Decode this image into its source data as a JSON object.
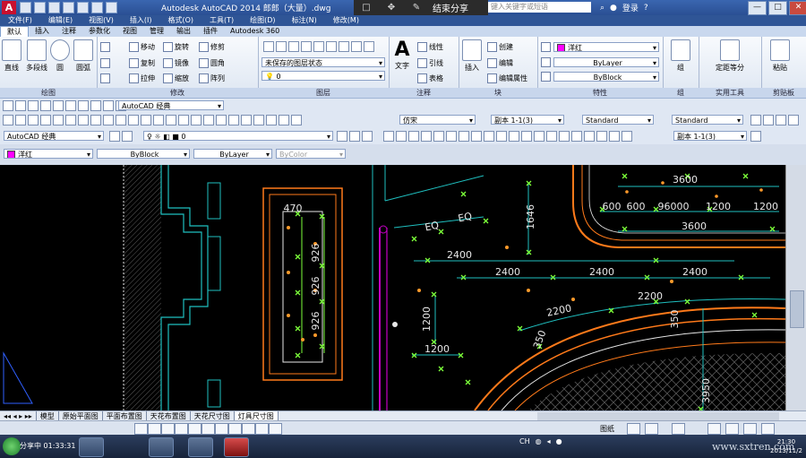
{
  "titlebar": {
    "app_icon_letter": "A",
    "title": "Autodesk AutoCAD 2014    郎郎（大量）.dwg",
    "share_label": "结束分享",
    "search_placeholder": "键入关键字或短语",
    "login_label": "登录",
    "buttons": [
      "—",
      "□",
      "✕"
    ]
  },
  "menubar": [
    "文件(F)",
    "编辑(E)",
    "视图(V)",
    "插入(I)",
    "格式(O)",
    "工具(T)",
    "绘图(D)",
    "标注(N)",
    "修改(M)"
  ],
  "ribbon_tabs": [
    "默认",
    "插入",
    "注释",
    "参数化",
    "视图",
    "管理",
    "输出",
    "插件",
    "Autodesk 360"
  ],
  "ribbon": {
    "draw": {
      "title": "绘图",
      "tools": [
        "直线",
        "多段线",
        "圆",
        "圆弧"
      ]
    },
    "modify": {
      "title": "修改",
      "tools": [
        "移动",
        "旋转",
        "修剪",
        "复制",
        "镜像",
        "圆角",
        "拉伸",
        "缩放",
        "阵列"
      ]
    },
    "layers": {
      "title": "图层",
      "state_value": "未保存的图层状态",
      "layer_value": "0"
    },
    "annotation": {
      "title": "注释",
      "text_label": "文字",
      "tools": [
        "线性",
        "引线",
        "表格"
      ]
    },
    "block": {
      "title": "块",
      "insert_label": "插入",
      "tools": [
        "创建",
        "编辑",
        "编辑属性"
      ]
    },
    "properties": {
      "title": "特性",
      "color_value": "洋红",
      "linetype_value": "ByLayer",
      "lineweight_value": "ByBlock"
    },
    "groups": {
      "title": "组",
      "label": "组"
    },
    "utilities": {
      "title": "实用工具",
      "label": "测量",
      "sub": "定距等分"
    },
    "clipboard": {
      "title": "剪贴板",
      "label": "粘贴"
    }
  },
  "toolbar_row1": {
    "workspace": "AutoCAD 经典"
  },
  "toolbar_row2": {
    "text_style": "仿宋",
    "dim_scale": "副本 1-1(3)",
    "style1": "Standard",
    "style2": "Standard"
  },
  "toolbar_row3": {
    "workspace": "AutoCAD 经典",
    "layer_value": "0",
    "dim_style": "副本 1-1(3)"
  },
  "toolbar_row4": {
    "color_value": "洋红",
    "linetype_value": "ByBlock",
    "lineweight_value": "ByLayer",
    "plotstyle_value": "ByColor"
  },
  "drawing_labels": {
    "top_row": [
      "3600"
    ],
    "second_row": [
      "600",
      "600",
      "96000",
      "1200",
      "1200"
    ],
    "third_row": [
      "3600"
    ],
    "left_column": [
      "470",
      "926",
      "926",
      "926"
    ],
    "eq": [
      "EQ",
      "EQ"
    ],
    "mid": [
      "1646",
      "2400",
      "2400",
      "2400",
      "2400",
      "2200",
      "2200",
      "350",
      "350",
      "1200",
      "1200",
      "3950"
    ]
  },
  "layout_tabs": [
    "模型",
    "原始平面图",
    "平面布置图",
    "天花布置图",
    "天花尺寸图",
    "灯具尺寸图"
  ],
  "statusbar": {
    "model_label": "图纸"
  },
  "taskbar": {
    "share_status": "分享中 01:33:31",
    "clock_time": "21:30",
    "clock_date": "2013/11/2"
  },
  "watermark": "www.sxtren.com",
  "colors": {
    "canvas_bg": "#000000",
    "cad_green": "#7dff3a",
    "cad_cyan": "#1fbfbf",
    "cad_orange": "#ff7a1a",
    "cad_magenta": "#c400c4",
    "cad_white": "#e8e8e8"
  }
}
